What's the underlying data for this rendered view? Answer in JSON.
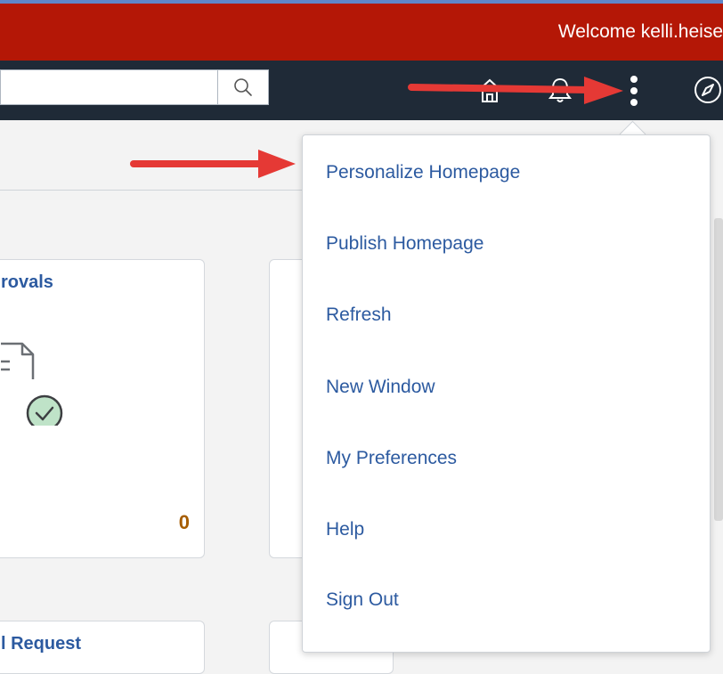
{
  "header": {
    "welcome_text": "Welcome kelli.heise"
  },
  "search": {
    "value": "",
    "placeholder": ""
  },
  "nav_icons": [
    "home-icon",
    "bell-icon",
    "more-vertical-icon",
    "compass-icon"
  ],
  "tiles": [
    {
      "title": "rovals",
      "count": "0"
    },
    {
      "title": "",
      "count": ""
    }
  ],
  "bottom_tile": {
    "title": "l Request"
  },
  "actions_menu": {
    "items": [
      {
        "label": "Personalize Homepage"
      },
      {
        "label": "Publish Homepage"
      },
      {
        "label": "Refresh"
      },
      {
        "label": "New Window"
      },
      {
        "label": "My Preferences"
      },
      {
        "label": "Help"
      },
      {
        "label": "Sign Out"
      }
    ]
  },
  "colors": {
    "brand_bar": "#b41706",
    "nav_bar": "#1f2a37",
    "menu_text": "#2c5aa0",
    "count": "#a65d00",
    "annotation_arrow": "#e53935"
  }
}
